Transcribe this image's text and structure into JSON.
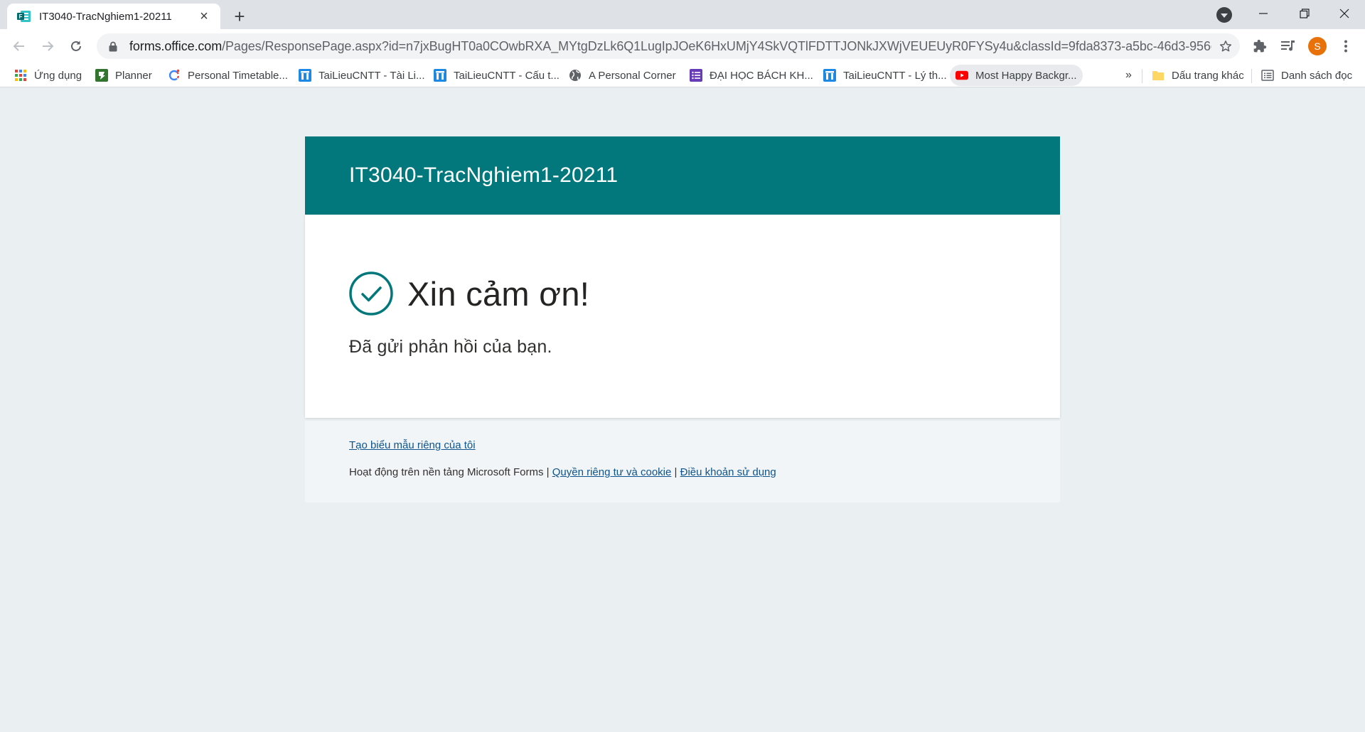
{
  "browser": {
    "tab": {
      "title": "IT3040-TracNghiem1-20211"
    },
    "address_bar": {
      "host": "forms.office.com",
      "path": "/Pages/ResponsePage.aspx?id=n7jxBugHT0a0COwbRXA_MYtgDzLk6Q1LugIpJOeK6HxUMjY4SkVQTlFDTTJONkJXWjVEUEUyR0FYSy4u&classId=9fda8373-a5bc-46d3-956c-adee5c6..."
    },
    "profile_initial": "S",
    "bookmarks": [
      {
        "label": "Ứng dụng",
        "icon": "apps-grid-icon"
      },
      {
        "label": "Planner",
        "icon": "planner-icon"
      },
      {
        "label": "Personal Timetable...",
        "icon": "timetable-icon"
      },
      {
        "label": "TaiLieuCNTT - Tài Li...",
        "icon": "tailieucntt-icon"
      },
      {
        "label": "TaiLieuCNTT - Cấu t...",
        "icon": "tailieucntt-icon"
      },
      {
        "label": "A Personal Corner",
        "icon": "globe-icon"
      },
      {
        "label": "ĐẠI HỌC BÁCH KH...",
        "icon": "forms-list-icon"
      },
      {
        "label": "TaiLieuCNTT - Lý th...",
        "icon": "tailieucntt-icon"
      },
      {
        "label": "Most Happy Backgr...",
        "icon": "youtube-icon"
      }
    ],
    "overflow_label": "»",
    "other_bookmarks": "Dấu trang khác",
    "reading_list": "Danh sách đọc"
  },
  "form": {
    "title": "IT3040-TracNghiem1-20211",
    "thanks_heading": "Xin cảm ơn!",
    "submitted_message": "Đã gửi phản hồi của bạn.",
    "create_own_link": "Tạo biểu mẫu riêng của tôi",
    "powered_by": "Hoạt động trên nền tảng Microsoft Forms",
    "separator": "|",
    "privacy_link": "Quyền riêng tư và cookie",
    "terms_link": "Điều khoản sử dụng"
  },
  "colors": {
    "header_teal": "#03787c",
    "link_blue": "#0f548c",
    "page_bg": "#eaeff2",
    "avatar_orange": "#e8710a"
  }
}
